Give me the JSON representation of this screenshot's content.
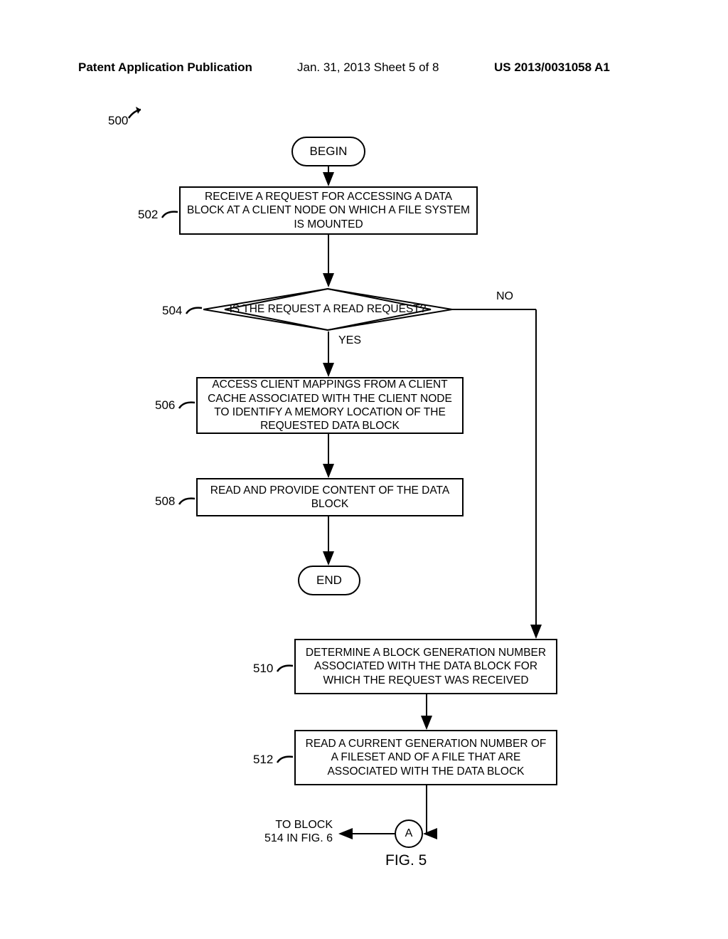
{
  "header": {
    "left": "Patent Application Publication",
    "center": "Jan. 31, 2013  Sheet 5 of 8",
    "right": "US 2013/0031058 A1"
  },
  "flow": {
    "ref500": "500",
    "begin": "BEGIN",
    "step502": {
      "ref": "502",
      "text": "RECEIVE A REQUEST FOR ACCESSING A DATA BLOCK AT A CLIENT NODE ON WHICH A FILE SYSTEM IS MOUNTED"
    },
    "dec504": {
      "ref": "504",
      "text": "IS THE REQUEST A READ REQUEST?",
      "yes": "YES",
      "no": "NO"
    },
    "step506": {
      "ref": "506",
      "text": "ACCESS CLIENT MAPPINGS FROM A CLIENT CACHE ASSOCIATED WITH THE CLIENT NODE TO IDENTIFY A MEMORY LOCATION OF THE REQUESTED DATA BLOCK"
    },
    "step508": {
      "ref": "508",
      "text": "READ AND PROVIDE CONTENT OF THE DATA BLOCK"
    },
    "end": "END",
    "step510": {
      "ref": "510",
      "text": "DETERMINE A BLOCK GENERATION NUMBER ASSOCIATED WITH THE DATA BLOCK FOR WHICH THE REQUEST WAS RECEIVED"
    },
    "step512": {
      "ref": "512",
      "text": "READ A CURRENT GENERATION NUMBER OF A FILESET AND OF A FILE THAT ARE ASSOCIATED WITH THE DATA BLOCK"
    },
    "connectorA": "A",
    "to_block": "TO BLOCK\n514 IN FIG. 6",
    "fig_caption": "FIG. 5"
  }
}
